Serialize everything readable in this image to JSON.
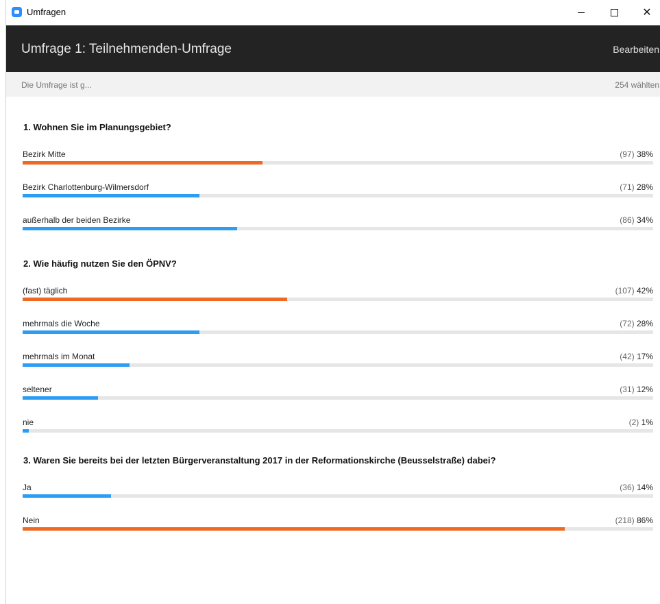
{
  "window": {
    "title": "Umfragen"
  },
  "header": {
    "poll_title": "Umfrage 1: Teilnehmenden-Umfrage",
    "edit_label": "Bearbeiten"
  },
  "status": {
    "text": "Die Umfrage ist g...",
    "votes": "254 wählten"
  },
  "colors": {
    "highlight": "#ee6a24",
    "normal": "#2d9df4",
    "track": "#e6e6e6",
    "header_bg": "#232323"
  },
  "questions": [
    {
      "title": "1. Wohnen Sie im Planungsgebiet?",
      "answers": [
        {
          "label": "Bezirk Mitte",
          "count": "(97)",
          "percent": "38%",
          "value": 38,
          "top": true
        },
        {
          "label": "Bezirk Charlottenburg-Wilmersdorf",
          "count": "(71)",
          "percent": "28%",
          "value": 28,
          "top": false
        },
        {
          "label": "außerhalb der beiden Bezirke",
          "count": "(86)",
          "percent": "34%",
          "value": 34,
          "top": false
        }
      ]
    },
    {
      "title": "2. Wie häufig nutzen Sie den ÖPNV?",
      "answers": [
        {
          "label": "(fast) täglich",
          "count": "(107)",
          "percent": "42%",
          "value": 42,
          "top": true
        },
        {
          "label": "mehrmals die Woche",
          "count": "(72)",
          "percent": "28%",
          "value": 28,
          "top": false
        },
        {
          "label": "mehrmals im Monat",
          "count": "(42)",
          "percent": "17%",
          "value": 17,
          "top": false
        },
        {
          "label": "seltener",
          "count": "(31)",
          "percent": "12%",
          "value": 12,
          "top": false
        },
        {
          "label": "nie",
          "count": "(2)",
          "percent": "1%",
          "value": 1,
          "top": false
        }
      ]
    },
    {
      "title": "3. Waren Sie bereits bei der letzten Bürgerveranstaltung 2017 in der Reformationskirche (Beusselstraße) dabei?",
      "answers": [
        {
          "label": "Ja",
          "count": "(36)",
          "percent": "14%",
          "value": 14,
          "top": false
        },
        {
          "label": "Nein",
          "count": "(218)",
          "percent": "86%",
          "value": 86,
          "top": true
        }
      ]
    }
  ]
}
